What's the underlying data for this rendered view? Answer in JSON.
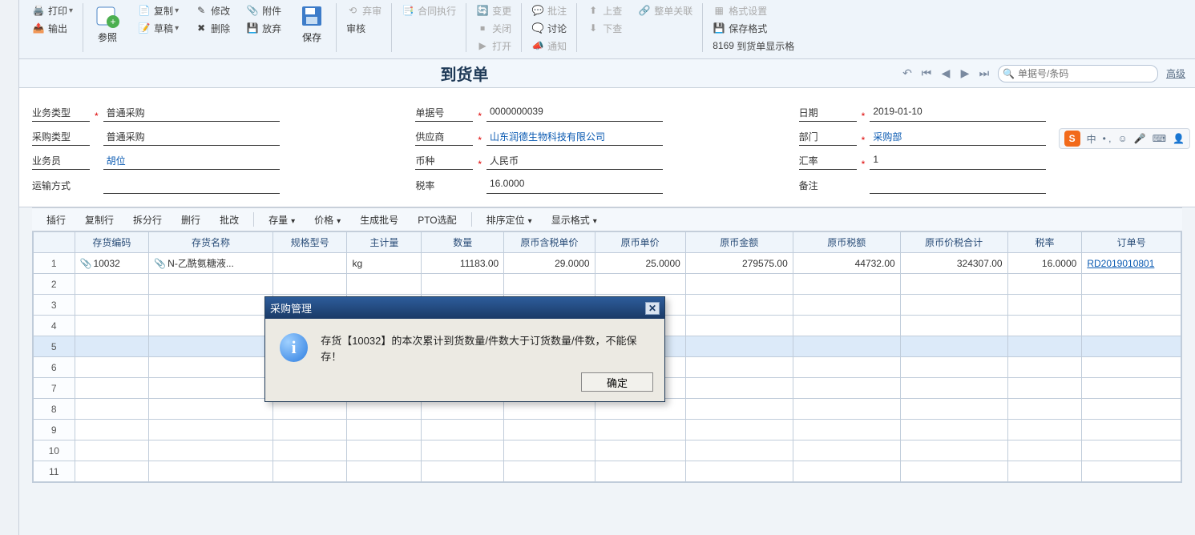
{
  "ribbon": {
    "print": "打印",
    "output": "输出",
    "reference": "参照",
    "copy": "复制",
    "draft": "草稿",
    "modify": "修改",
    "delete": "删除",
    "attach": "附件",
    "discard": "放弃",
    "save": "保存",
    "abandon_review": "弃审",
    "review": "审核",
    "contract_exec": "合同执行",
    "change": "变更",
    "close": "关闭",
    "open": "打开",
    "batch": "批注",
    "discuss": "讨论",
    "notify": "通知",
    "up_query": "上查",
    "down_query": "下查",
    "whole_link": "整单关联",
    "format_setting": "格式设置",
    "save_format": "保存格式",
    "format_code": "8169",
    "format_name": "到货单显示格"
  },
  "titlebar": {
    "doc_title": "到货单",
    "search_placeholder": "单据号/条码",
    "advanced": "高级"
  },
  "form": {
    "biz_type_label": "业务类型",
    "biz_type_value": "普通采购",
    "purch_type_label": "采购类型",
    "purch_type_value": "普通采购",
    "operator_label": "业务员",
    "operator_value": "胡位",
    "ship_mode_label": "运输方式",
    "ship_mode_value": "",
    "doc_no_label": "单据号",
    "doc_no_value": "0000000039",
    "supplier_label": "供应商",
    "supplier_value": "山东润德生物科技有限公司",
    "currency_label": "币种",
    "currency_value": "人民币",
    "tax_rate_label": "税率",
    "tax_rate_value": "16.0000",
    "date_label": "日期",
    "date_value": "2019-01-10",
    "dept_label": "部门",
    "dept_value": "采购部",
    "exch_rate_label": "汇率",
    "exch_rate_value": "1",
    "remark_label": "备注",
    "remark_value": ""
  },
  "sogou": {
    "zhong": "中"
  },
  "grid_toolbar": {
    "insert_row": "插行",
    "copy_row": "复制行",
    "split_row": "拆分行",
    "delete_row": "删行",
    "batch_edit": "批改",
    "stock_qty": "存量",
    "price": "价格",
    "gen_batch": "生成批号",
    "pto": "PTO选配",
    "sort_locate": "排序定位",
    "display_fmt": "显示格式"
  },
  "grid": {
    "headers": {
      "stock_code": "存货编码",
      "stock_name": "存货名称",
      "spec": "规格型号",
      "main_unit": "主计量",
      "qty": "数量",
      "tax_price": "原币含税单价",
      "unit_price": "原币单价",
      "amount": "原币金额",
      "tax_amount": "原币税额",
      "total": "原币价税合计",
      "tax_rate_c": "税率",
      "order_no": "订单号"
    },
    "rows": [
      {
        "idx": "1",
        "stock_code": "10032",
        "stock_name": "N-乙酰氨糖液...",
        "spec": "",
        "main_unit": "kg",
        "qty": "11183.00",
        "tax_price": "29.0000",
        "unit_price": "25.0000",
        "amount": "279575.00",
        "tax_amount": "44732.00",
        "total": "324307.00",
        "tax_rate_c": "16.0000",
        "order_no": "RD2019010801"
      }
    ]
  },
  "dialog": {
    "title": "采购管理",
    "message": "存货【10032】的本次累计到货数量/件数大于订货数量/件数，不能保存！",
    "ok": "确定"
  }
}
